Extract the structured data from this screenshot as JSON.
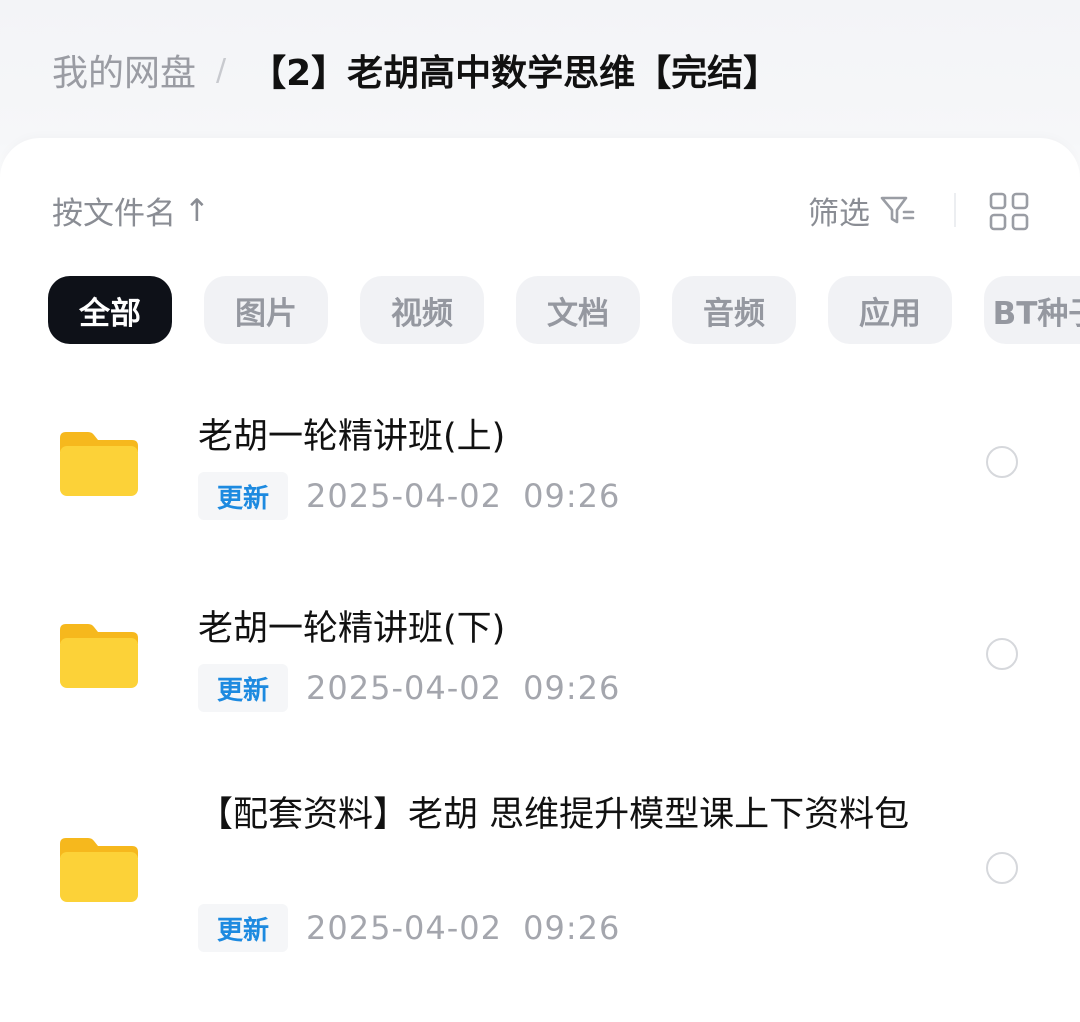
{
  "breadcrumb": {
    "root": "我的网盘",
    "separator": "/",
    "current": "【2】老胡高中数学思维【完结】"
  },
  "toolbar": {
    "sort_label": "按文件名",
    "sort_arrow": "↑",
    "filter_label": "筛选",
    "filter_icon": "filter-icon",
    "view_icon": "grid-view-icon"
  },
  "chips": [
    {
      "label": "全部",
      "active": true
    },
    {
      "label": "图片",
      "active": false
    },
    {
      "label": "视频",
      "active": false
    },
    {
      "label": "文档",
      "active": false
    },
    {
      "label": "音频",
      "active": false
    },
    {
      "label": "应用",
      "active": false
    },
    {
      "label": "BT种子",
      "active": false
    }
  ],
  "files": [
    {
      "name": "老胡一轮精讲班(上)",
      "badge": "更新",
      "time": "2025-04-02 09:26",
      "icon": "folder-icon"
    },
    {
      "name": "老胡一轮精讲班(下)",
      "badge": "更新",
      "time": "2025-04-02 09:26",
      "icon": "folder-icon"
    },
    {
      "name": "【配套资料】老胡 思维提升模型课上下资料包",
      "badge": "更新",
      "time": "2025-04-02 09:26",
      "icon": "folder-icon"
    }
  ],
  "colors": {
    "active_chip_bg": "#0e1118",
    "chip_bg": "#f1f2f5",
    "badge_text": "#1d8ae0",
    "folder_yellow": "#fcd238",
    "folder_tab": "#f6b81d"
  }
}
